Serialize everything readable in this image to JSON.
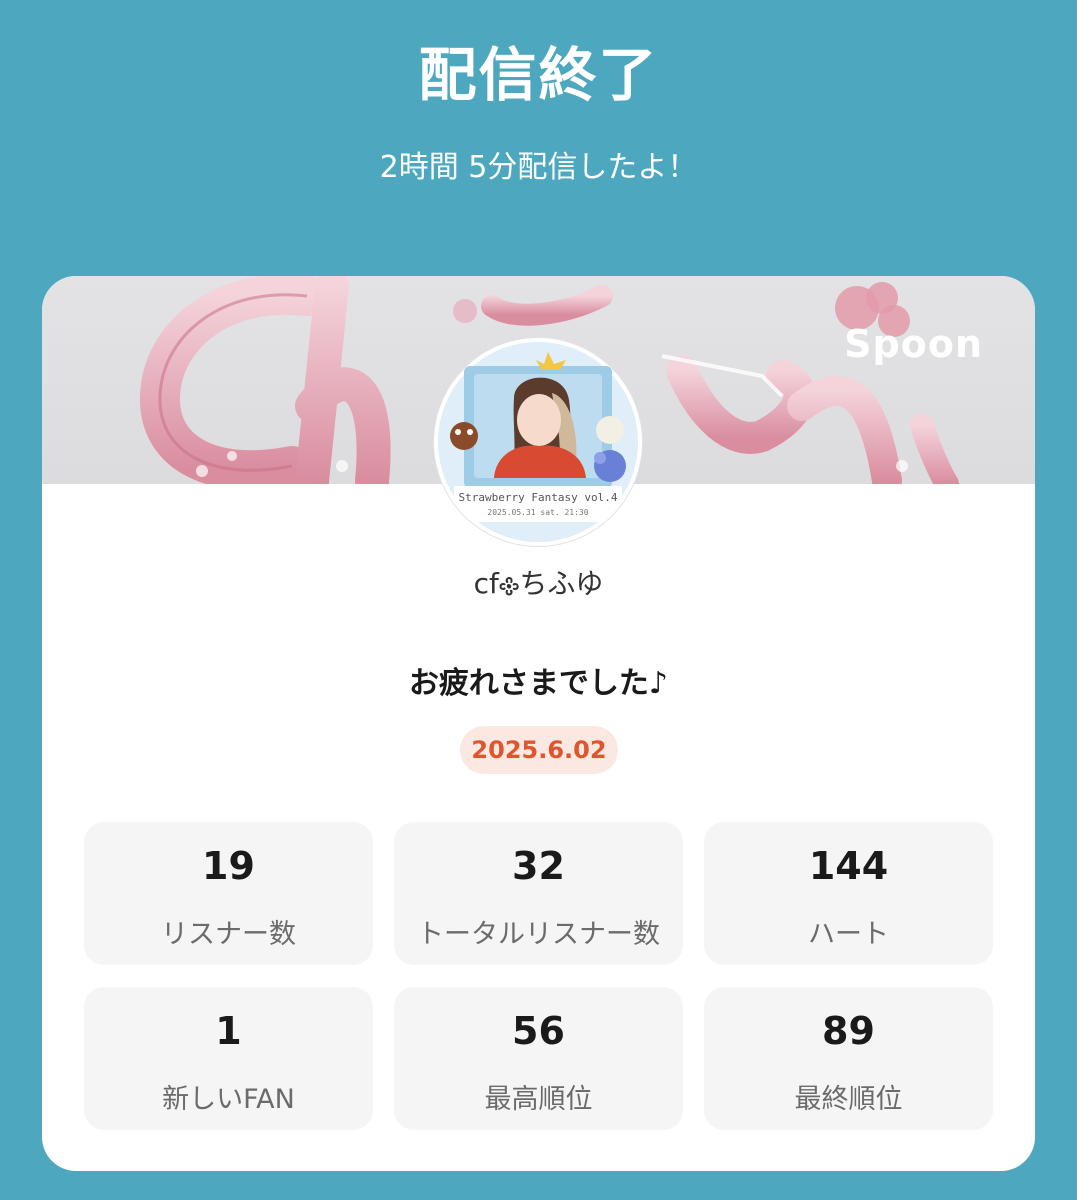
{
  "header": {
    "title": "配信終了",
    "subtitle": "2時間 5分配信したよ！"
  },
  "card": {
    "brand": "Spoon",
    "username": "cf𐫱ちふゆ",
    "message": "お疲れさまでした♪",
    "date": "2025.6.02",
    "stats": [
      {
        "value": "19",
        "label": "リスナー数"
      },
      {
        "value": "32",
        "label": "トータルリスナー数"
      },
      {
        "value": "144",
        "label": "ハート"
      },
      {
        "value": "1",
        "label": "新しいFAN"
      },
      {
        "value": "56",
        "label": "最高順位"
      },
      {
        "value": "89",
        "label": "最終順位"
      }
    ]
  },
  "colors": {
    "background": "#4da8bf",
    "card": "#ffffff",
    "date_badge_bg": "#fbe8e2",
    "date_badge_text": "#e0562c",
    "stat_tile": "#f5f5f5"
  }
}
